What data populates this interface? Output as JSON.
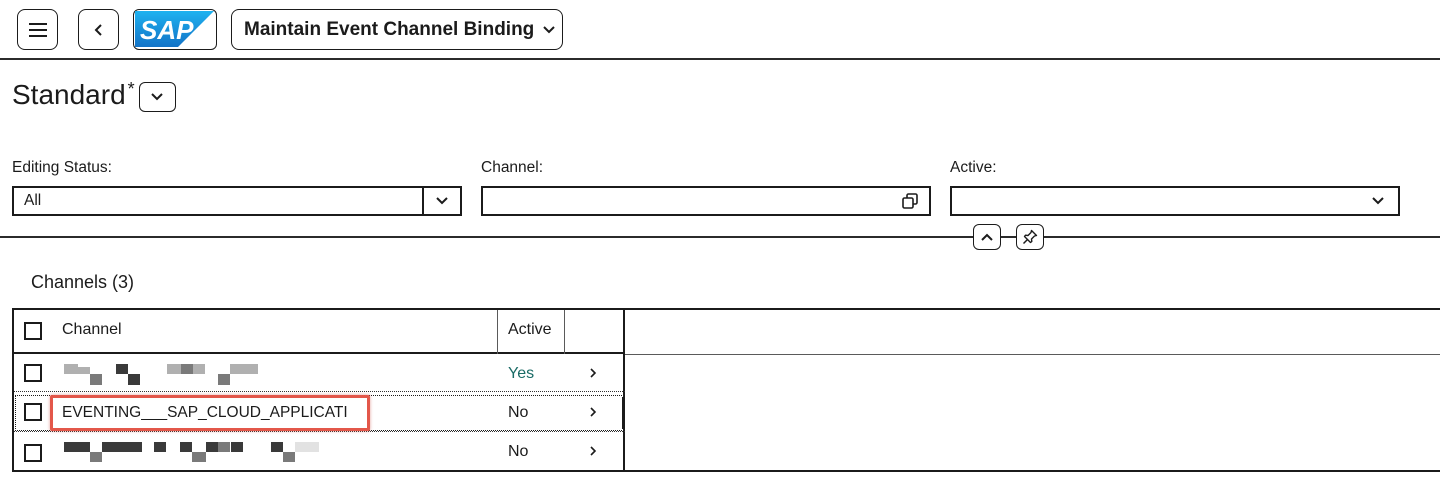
{
  "shell": {
    "logo_text": "SAP",
    "app_title": "Maintain Event Channel Binding",
    "brand_color": "#1a8fd8"
  },
  "variant": {
    "name": "Standard",
    "modified_marker": "*"
  },
  "filters": {
    "editing_status": {
      "label": "Editing Status:",
      "value": "All"
    },
    "channel": {
      "label": "Channel:",
      "value": ""
    },
    "active": {
      "label": "Active:",
      "value": ""
    }
  },
  "table": {
    "title": "Channels (3)",
    "columns": [
      "Channel",
      "Active"
    ],
    "rows": [
      {
        "channel": "",
        "active": "Yes",
        "redacted": true
      },
      {
        "channel": "EVENTING___SAP_CLOUD_APPLICATI",
        "active": "No",
        "redacted": false,
        "highlighted": true
      },
      {
        "channel": "",
        "active": "No",
        "redacted": true
      }
    ],
    "active_yes_color": "#1a6b66",
    "highlight_color": "#e3574a"
  },
  "icons": {
    "menu": "hamburger-icon",
    "back": "chevron-left-icon",
    "title_dropdown": "chevron-down-icon",
    "value_help": "copy-value-help-icon",
    "collapse": "chevron-up-icon",
    "pin": "pin-icon",
    "navigation": "chevron-right-icon"
  }
}
